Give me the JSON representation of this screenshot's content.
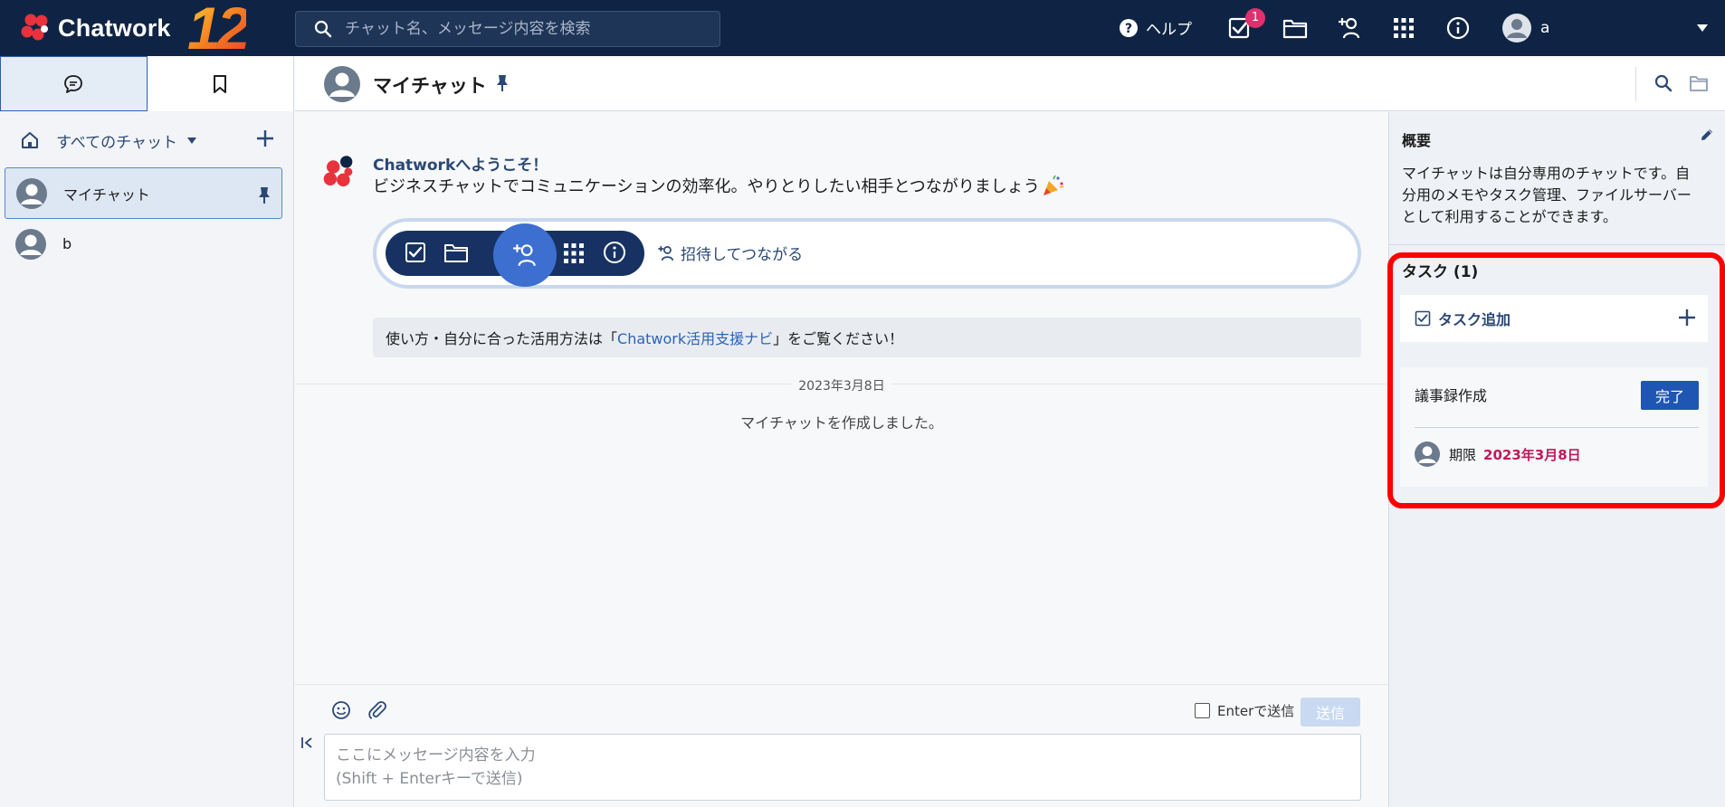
{
  "app": {
    "brand": "Chatwork",
    "anniversary": "12"
  },
  "topbar": {
    "search_placeholder": "チャット名、メッセージ内容を検索",
    "help_label": "ヘルプ",
    "task_badge": "1",
    "user_name": "a"
  },
  "sidebar": {
    "filter_label": "すべてのチャット",
    "rooms": [
      {
        "name": "マイチャット",
        "pinned": true,
        "active": true
      },
      {
        "name": "b",
        "pinned": false,
        "active": false
      }
    ]
  },
  "chat": {
    "title": "マイチャット",
    "welcome_title": "Chatworkへようこそ！",
    "welcome_body": "ビジネスチャットでコミュニケーションの効率化。やりとりしたい相手とつながりましょう",
    "invite_label": "招待してつながる",
    "tips_before": "使い方・自分に合った活用方法は「",
    "tips_link": "Chatwork活用支援ナビ",
    "tips_after": "」をご覧ください！",
    "date": "2023年3月8日",
    "system_message": "マイチャットを作成しました。"
  },
  "composer": {
    "enter_send_label": "Enterで送信",
    "send_label": "送信",
    "placeholder_line1": "ここにメッセージ内容を入力",
    "placeholder_line2": "(Shift + Enterキーで送信)"
  },
  "overview": {
    "title": "概要",
    "description": "マイチャットは自分専用のチャットです。自分用のメモやタスク管理、ファイルサーバーとして利用することができます。"
  },
  "tasks": {
    "title": "タスク (1)",
    "add_label": "タスク追加",
    "items": [
      {
        "name": "議事録作成",
        "done_label": "完了",
        "due_label": "期限",
        "due_date": "2023年3月8日"
      }
    ]
  },
  "colors": {
    "topbar_bg": "#0f2444",
    "accent": "#1f56b3",
    "due_date": "#c2185b",
    "highlight": "#ff0000"
  }
}
